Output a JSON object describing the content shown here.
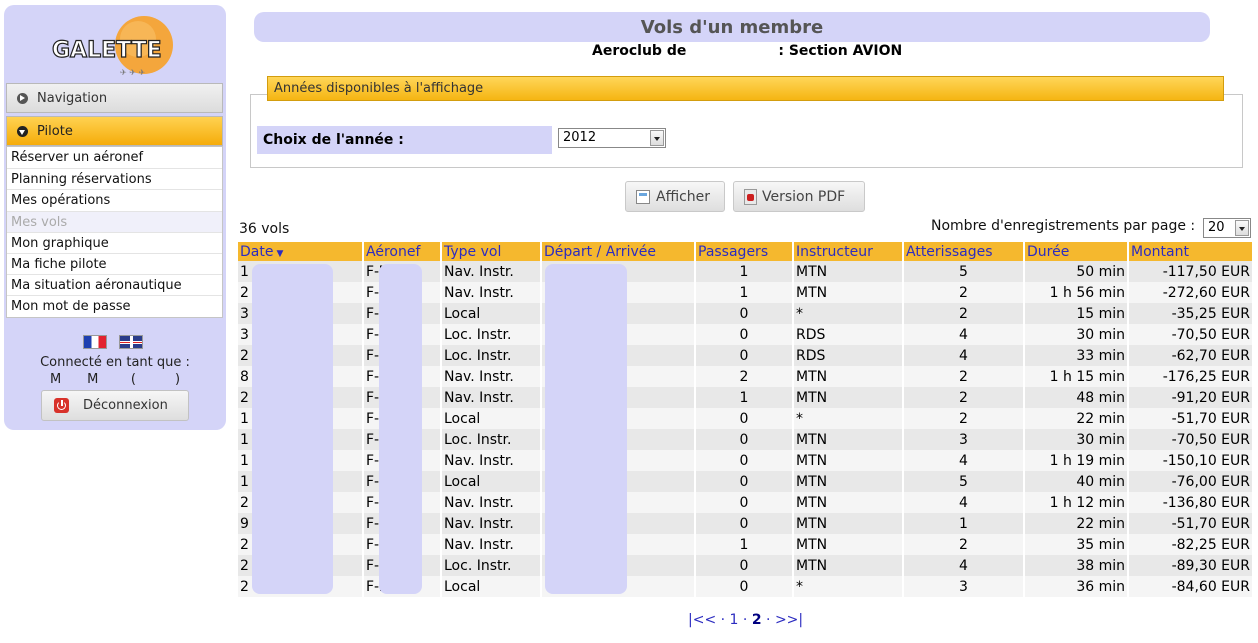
{
  "sidebar": {
    "logo_text": "GALETTE",
    "nav_header": "Navigation",
    "pilote_header": "Pilote",
    "menu": [
      "Réserver un aéronef",
      "Planning réservations",
      "Mes opérations",
      "Mes vols",
      "Mon graphique",
      "Ma fiche pilote",
      "Ma situation aéronautique",
      "Mon mot de passe"
    ],
    "connected_label": "Connecté en tant que :",
    "connected_user": "M    M     (      )",
    "logout_label": "Déconnexion"
  },
  "header": {
    "title": "Vols d'un membre",
    "aeroclub": "Aeroclub de",
    "section": ": Section AVION"
  },
  "year_filter": {
    "legend": "Années disponibles à l'affichage",
    "label": "Choix de l'année :",
    "selected": "2012"
  },
  "buttons": {
    "show": "Afficher",
    "pdf": "Version PDF"
  },
  "list": {
    "count": "36 vols",
    "per_page_label": "Nombre d'enregistrements par page :",
    "per_page_value": "20",
    "columns": [
      "Date",
      "Aéronef",
      "Type vol",
      "Départ / Arrivée",
      "Passagers",
      "Instructeur",
      "Atterissages",
      "Durée",
      "Montant"
    ],
    "rows": [
      [
        "1",
        "F-B",
        "Nav. Instr.",
        "",
        "1",
        "MTN",
        "5",
        "50 min",
        "-117,50 EUR"
      ],
      [
        "2",
        "F-B",
        "Nav. Instr.",
        "",
        "1",
        "MTN",
        "2",
        "1 h 56 min",
        "-272,60 EUR"
      ],
      [
        "3",
        "F-B",
        "Local",
        "",
        "0",
        "*",
        "2",
        "15 min",
        "-35,25 EUR"
      ],
      [
        "3",
        "F-B",
        "Loc. Instr.",
        "",
        "0",
        "RDS",
        "4",
        "30 min",
        "-70,50 EUR"
      ],
      [
        "2",
        "F-G",
        "Loc. Instr.",
        "",
        "0",
        "RDS",
        "4",
        "33 min",
        "-62,70 EUR"
      ],
      [
        "8",
        "F-B",
        "Nav. Instr.",
        "",
        "2",
        "MTN",
        "2",
        "1 h 15 min",
        "-176,25 EUR"
      ],
      [
        "2",
        "F-G",
        "Nav. Instr.",
        "",
        "1",
        "MTN",
        "2",
        "48 min",
        "-91,20 EUR"
      ],
      [
        "1",
        "F-B",
        "Local",
        "",
        "0",
        "*",
        "2",
        "22 min",
        "-51,70 EUR"
      ],
      [
        "1",
        "F-B",
        "Loc. Instr.",
        "",
        "0",
        "MTN",
        "3",
        "30 min",
        "-70,50 EUR"
      ],
      [
        "1",
        "F-G",
        "Nav. Instr.",
        "",
        "0",
        "MTN",
        "4",
        "1 h 19 min",
        "-150,10 EUR"
      ],
      [
        "1",
        "F-G",
        "Local",
        "",
        "0",
        "MTN",
        "5",
        "40 min",
        "-76,00 EUR"
      ],
      [
        "2",
        "F-G",
        "Nav. Instr.",
        "",
        "0",
        "MTN",
        "4",
        "1 h 12 min",
        "-136,80 EUR"
      ],
      [
        "9",
        "F-B",
        "Nav. Instr.",
        "",
        "0",
        "MTN",
        "1",
        "22 min",
        "-51,70 EUR"
      ],
      [
        "2",
        "F-B",
        "Nav. Instr.",
        "",
        "1",
        "MTN",
        "2",
        "35 min",
        "-82,25 EUR"
      ],
      [
        "2",
        "F-B",
        "Loc. Instr.",
        "",
        "0",
        "MTN",
        "4",
        "38 min",
        "-89,30 EUR"
      ],
      [
        "2",
        "F-B",
        "Local",
        "",
        "0",
        "*",
        "3",
        "36 min",
        "-84,60 EUR"
      ]
    ]
  },
  "pager": {
    "first": "|<<",
    "page1": "1",
    "page2": "2",
    "last": ">>|",
    "sep": "·"
  }
}
